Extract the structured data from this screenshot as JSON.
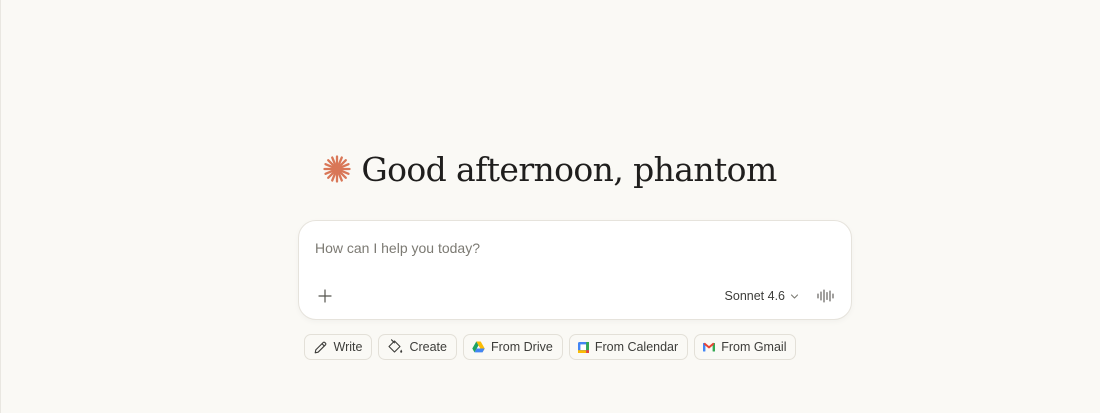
{
  "greeting": {
    "text": "Good afternoon, phantom",
    "icon": "spark-icon",
    "accent_color": "#d97757"
  },
  "composer": {
    "placeholder": "How can I help you today?",
    "value": "",
    "model_label": "Sonnet 4.6"
  },
  "suggestions": [
    {
      "label": "Write",
      "icon": "pencil-icon"
    },
    {
      "label": "Create",
      "icon": "paint-bucket-icon"
    },
    {
      "label": "From Drive",
      "icon": "google-drive-icon"
    },
    {
      "label": "From Calendar",
      "icon": "google-calendar-icon"
    },
    {
      "label": "From Gmail",
      "icon": "gmail-icon"
    }
  ],
  "colors": {
    "background": "#faf9f5",
    "text": "#3d3d3a",
    "accent": "#d97757"
  }
}
